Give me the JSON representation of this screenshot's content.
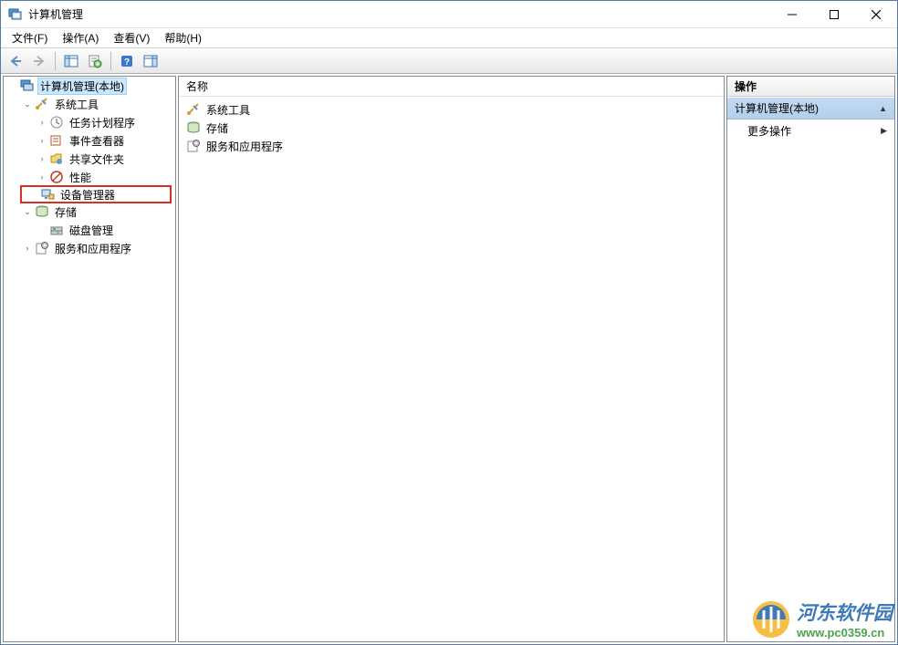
{
  "window": {
    "title": "计算机管理"
  },
  "menubar": {
    "items": [
      {
        "label": "文件(F)"
      },
      {
        "label": "操作(A)"
      },
      {
        "label": "查看(V)"
      },
      {
        "label": "帮助(H)"
      }
    ]
  },
  "tree": {
    "root": {
      "label": "计算机管理(本地)"
    },
    "children": [
      {
        "label": "系统工具",
        "expanded": true,
        "children": [
          {
            "label": "任务计划程序",
            "expanded": false
          },
          {
            "label": "事件查看器",
            "expanded": false
          },
          {
            "label": "共享文件夹",
            "expanded": false
          },
          {
            "label": "性能",
            "expanded": false
          },
          {
            "label": "设备管理器",
            "highlighted": true
          }
        ]
      },
      {
        "label": "存储",
        "expanded": true,
        "children": [
          {
            "label": "磁盘管理"
          }
        ]
      },
      {
        "label": "服务和应用程序",
        "expanded": false
      }
    ]
  },
  "list": {
    "header": "名称",
    "items": [
      {
        "label": "系统工具",
        "icon": "tools"
      },
      {
        "label": "存储",
        "icon": "storage"
      },
      {
        "label": "服务和应用程序",
        "icon": "services"
      }
    ]
  },
  "actions": {
    "header": "操作",
    "group_title": "计算机管理(本地)",
    "items": [
      {
        "label": "更多操作"
      }
    ]
  },
  "watermark": {
    "name": "河东软件园",
    "url": "www.pc0359.cn"
  }
}
